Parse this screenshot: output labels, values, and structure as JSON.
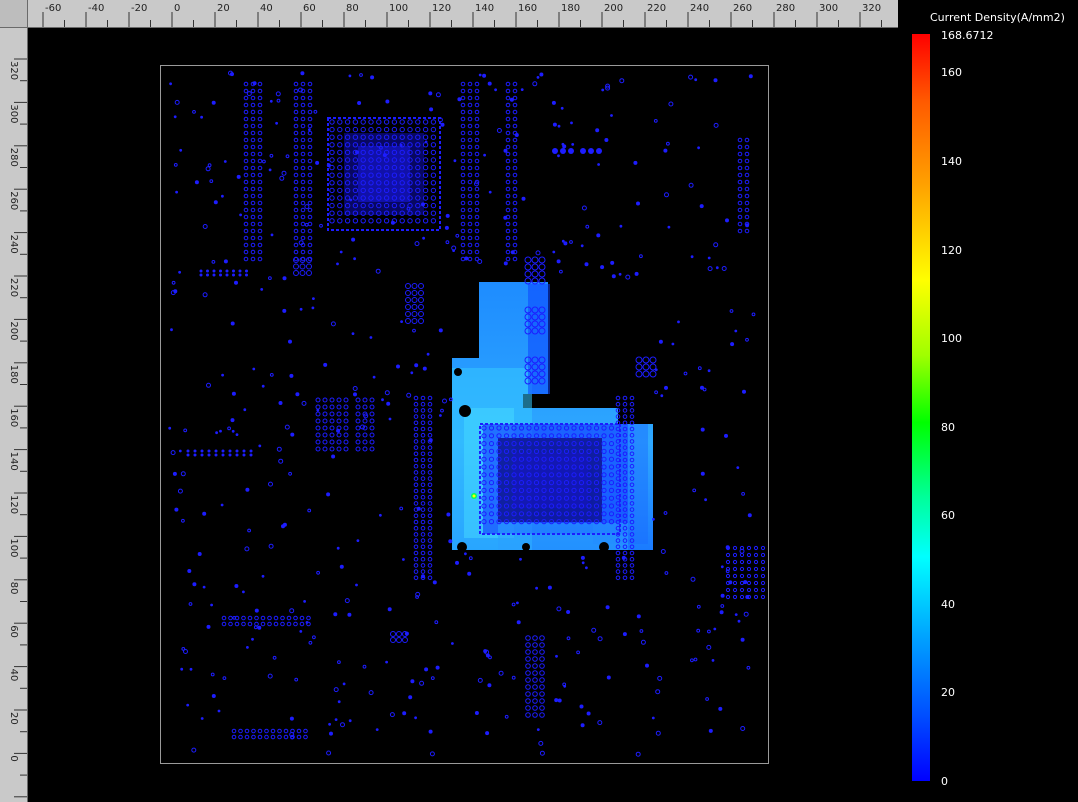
{
  "ruler": {
    "horizontal_labels": [
      "-60",
      "-40",
      "-20",
      "0",
      "20",
      "40",
      "60",
      "80",
      "100",
      "120",
      "140",
      "160",
      "180",
      "200",
      "220",
      "240",
      "260",
      "280",
      "300",
      "320"
    ],
    "vertical_labels": [
      "320",
      "300",
      "280",
      "260",
      "240",
      "220",
      "200",
      "180",
      "160",
      "140",
      "120",
      "100",
      "80",
      "60",
      "40",
      "20",
      "0"
    ]
  },
  "legend": {
    "title": "Current Density(A/mm2)",
    "max_label": "168.6712",
    "tick_labels": [
      "160",
      "140",
      "120",
      "100",
      "80",
      "60",
      "40",
      "20",
      "0"
    ]
  },
  "colors": {
    "background": "#000000",
    "board_outline": "#9a9a9a",
    "via": "#1d1dff",
    "current_high": "#35c8ff",
    "current_low": "#1060ff"
  },
  "colorbar_scale": [
    "#ff0000",
    "#ffa000",
    "#ffff00",
    "#00ff00",
    "#00ffff",
    "#0050ff",
    "#0000ff"
  ]
}
